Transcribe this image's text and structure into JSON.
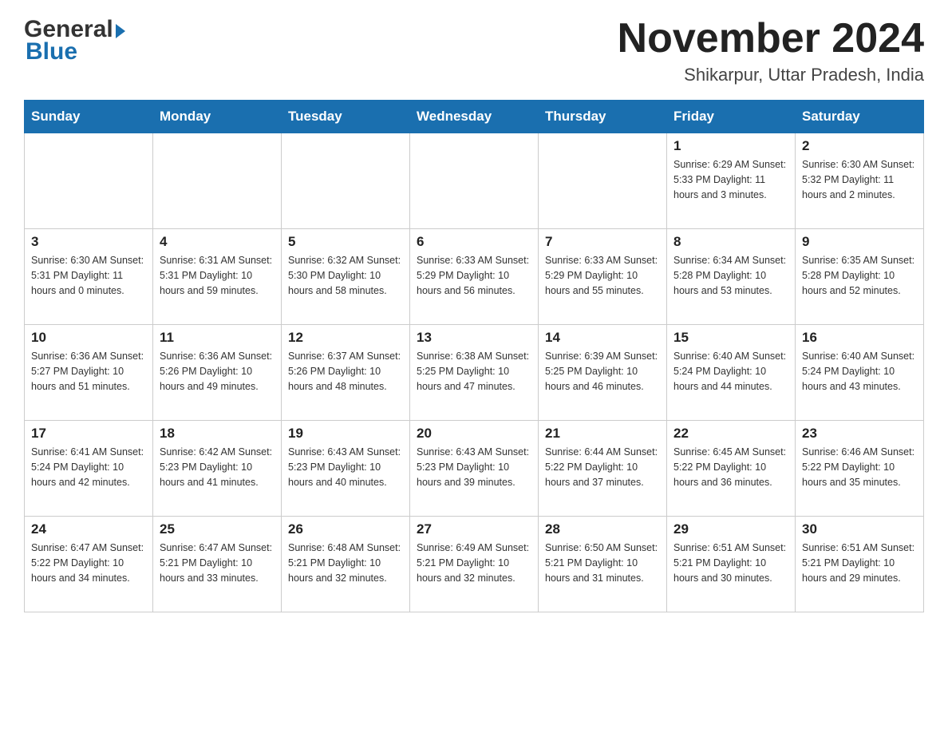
{
  "header": {
    "logo_general": "General",
    "logo_blue": "Blue",
    "month_year": "November 2024",
    "location": "Shikarpur, Uttar Pradesh, India"
  },
  "days_of_week": [
    "Sunday",
    "Monday",
    "Tuesday",
    "Wednesday",
    "Thursday",
    "Friday",
    "Saturday"
  ],
  "weeks": [
    [
      {
        "day": "",
        "info": ""
      },
      {
        "day": "",
        "info": ""
      },
      {
        "day": "",
        "info": ""
      },
      {
        "day": "",
        "info": ""
      },
      {
        "day": "",
        "info": ""
      },
      {
        "day": "1",
        "info": "Sunrise: 6:29 AM\nSunset: 5:33 PM\nDaylight: 11 hours and 3 minutes."
      },
      {
        "day": "2",
        "info": "Sunrise: 6:30 AM\nSunset: 5:32 PM\nDaylight: 11 hours and 2 minutes."
      }
    ],
    [
      {
        "day": "3",
        "info": "Sunrise: 6:30 AM\nSunset: 5:31 PM\nDaylight: 11 hours and 0 minutes."
      },
      {
        "day": "4",
        "info": "Sunrise: 6:31 AM\nSunset: 5:31 PM\nDaylight: 10 hours and 59 minutes."
      },
      {
        "day": "5",
        "info": "Sunrise: 6:32 AM\nSunset: 5:30 PM\nDaylight: 10 hours and 58 minutes."
      },
      {
        "day": "6",
        "info": "Sunrise: 6:33 AM\nSunset: 5:29 PM\nDaylight: 10 hours and 56 minutes."
      },
      {
        "day": "7",
        "info": "Sunrise: 6:33 AM\nSunset: 5:29 PM\nDaylight: 10 hours and 55 minutes."
      },
      {
        "day": "8",
        "info": "Sunrise: 6:34 AM\nSunset: 5:28 PM\nDaylight: 10 hours and 53 minutes."
      },
      {
        "day": "9",
        "info": "Sunrise: 6:35 AM\nSunset: 5:28 PM\nDaylight: 10 hours and 52 minutes."
      }
    ],
    [
      {
        "day": "10",
        "info": "Sunrise: 6:36 AM\nSunset: 5:27 PM\nDaylight: 10 hours and 51 minutes."
      },
      {
        "day": "11",
        "info": "Sunrise: 6:36 AM\nSunset: 5:26 PM\nDaylight: 10 hours and 49 minutes."
      },
      {
        "day": "12",
        "info": "Sunrise: 6:37 AM\nSunset: 5:26 PM\nDaylight: 10 hours and 48 minutes."
      },
      {
        "day": "13",
        "info": "Sunrise: 6:38 AM\nSunset: 5:25 PM\nDaylight: 10 hours and 47 minutes."
      },
      {
        "day": "14",
        "info": "Sunrise: 6:39 AM\nSunset: 5:25 PM\nDaylight: 10 hours and 46 minutes."
      },
      {
        "day": "15",
        "info": "Sunrise: 6:40 AM\nSunset: 5:24 PM\nDaylight: 10 hours and 44 minutes."
      },
      {
        "day": "16",
        "info": "Sunrise: 6:40 AM\nSunset: 5:24 PM\nDaylight: 10 hours and 43 minutes."
      }
    ],
    [
      {
        "day": "17",
        "info": "Sunrise: 6:41 AM\nSunset: 5:24 PM\nDaylight: 10 hours and 42 minutes."
      },
      {
        "day": "18",
        "info": "Sunrise: 6:42 AM\nSunset: 5:23 PM\nDaylight: 10 hours and 41 minutes."
      },
      {
        "day": "19",
        "info": "Sunrise: 6:43 AM\nSunset: 5:23 PM\nDaylight: 10 hours and 40 minutes."
      },
      {
        "day": "20",
        "info": "Sunrise: 6:43 AM\nSunset: 5:23 PM\nDaylight: 10 hours and 39 minutes."
      },
      {
        "day": "21",
        "info": "Sunrise: 6:44 AM\nSunset: 5:22 PM\nDaylight: 10 hours and 37 minutes."
      },
      {
        "day": "22",
        "info": "Sunrise: 6:45 AM\nSunset: 5:22 PM\nDaylight: 10 hours and 36 minutes."
      },
      {
        "day": "23",
        "info": "Sunrise: 6:46 AM\nSunset: 5:22 PM\nDaylight: 10 hours and 35 minutes."
      }
    ],
    [
      {
        "day": "24",
        "info": "Sunrise: 6:47 AM\nSunset: 5:22 PM\nDaylight: 10 hours and 34 minutes."
      },
      {
        "day": "25",
        "info": "Sunrise: 6:47 AM\nSunset: 5:21 PM\nDaylight: 10 hours and 33 minutes."
      },
      {
        "day": "26",
        "info": "Sunrise: 6:48 AM\nSunset: 5:21 PM\nDaylight: 10 hours and 32 minutes."
      },
      {
        "day": "27",
        "info": "Sunrise: 6:49 AM\nSunset: 5:21 PM\nDaylight: 10 hours and 32 minutes."
      },
      {
        "day": "28",
        "info": "Sunrise: 6:50 AM\nSunset: 5:21 PM\nDaylight: 10 hours and 31 minutes."
      },
      {
        "day": "29",
        "info": "Sunrise: 6:51 AM\nSunset: 5:21 PM\nDaylight: 10 hours and 30 minutes."
      },
      {
        "day": "30",
        "info": "Sunrise: 6:51 AM\nSunset: 5:21 PM\nDaylight: 10 hours and 29 minutes."
      }
    ]
  ]
}
